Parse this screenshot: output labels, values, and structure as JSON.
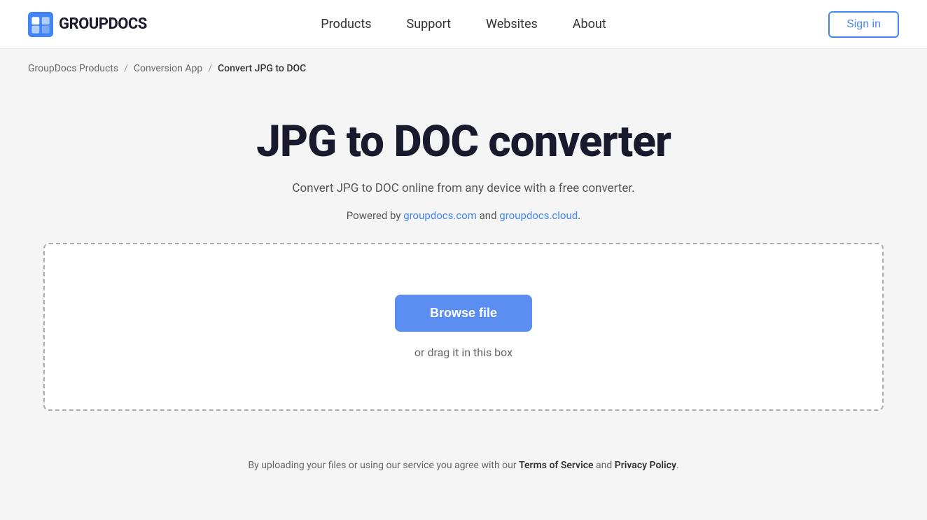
{
  "header": {
    "logo_text": "GROUPDOCS",
    "nav": {
      "products": "Products",
      "support": "Support",
      "websites": "Websites",
      "about": "About"
    },
    "sign_in": "Sign in"
  },
  "breadcrumb": {
    "item1": "GroupDocs Products",
    "separator1": "/",
    "item2": "Conversion App",
    "separator2": "/",
    "current": "Convert JPG to DOC"
  },
  "main": {
    "title": "JPG to DOC converter",
    "subtitle": "Convert JPG to DOC online from any device with a free converter.",
    "powered_by_prefix": "Powered by ",
    "powered_by_link1": "groupdocs.com",
    "powered_by_middle": " and ",
    "powered_by_link2": "groupdocs.cloud",
    "powered_by_suffix": ".",
    "browse_button": "Browse file",
    "drag_text": "or drag it in this box"
  },
  "footer": {
    "note_prefix": "By uploading your files or using our service you agree with our ",
    "tos_link": "Terms of Service",
    "note_middle": " and ",
    "privacy_link": "Privacy Policy",
    "note_suffix": "."
  },
  "colors": {
    "brand_blue": "#4285f4",
    "button_blue": "#5b8ef0",
    "logo_dark": "#1a1a2e"
  }
}
